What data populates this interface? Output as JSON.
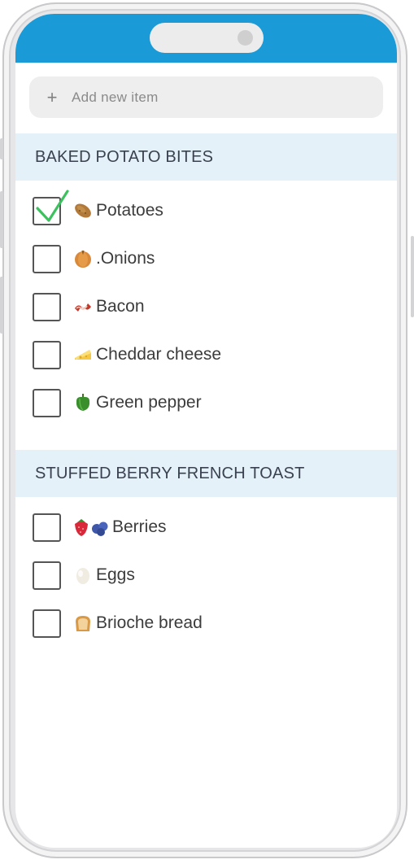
{
  "add_item": {
    "plus_icon": "+",
    "placeholder": "Add new item"
  },
  "sections": [
    {
      "title": "BAKED POTATO BITES",
      "items": [
        {
          "label": "Potatoes",
          "icon": "potato-icon",
          "checked": true
        },
        {
          "label": ".Onions",
          "icon": "onion-icon",
          "checked": false
        },
        {
          "label": "Bacon",
          "icon": "bacon-icon",
          "checked": false
        },
        {
          "label": "Cheddar cheese",
          "icon": "cheese-icon",
          "checked": false
        },
        {
          "label": "Green pepper",
          "icon": "bell-pepper-icon",
          "checked": false
        }
      ]
    },
    {
      "title": "STUFFED BERRY FRENCH TOAST",
      "items": [
        {
          "label": "Berries",
          "icon": "strawberry-blueberries-icon",
          "checked": false
        },
        {
          "label": "Eggs",
          "icon": "egg-icon",
          "checked": false
        },
        {
          "label": "Brioche bread",
          "icon": "bread-icon",
          "checked": false
        }
      ]
    }
  ],
  "colors": {
    "accent": "#1a9ad6",
    "section_bg": "#e4f1f8",
    "check_green": "#3cc15e"
  }
}
